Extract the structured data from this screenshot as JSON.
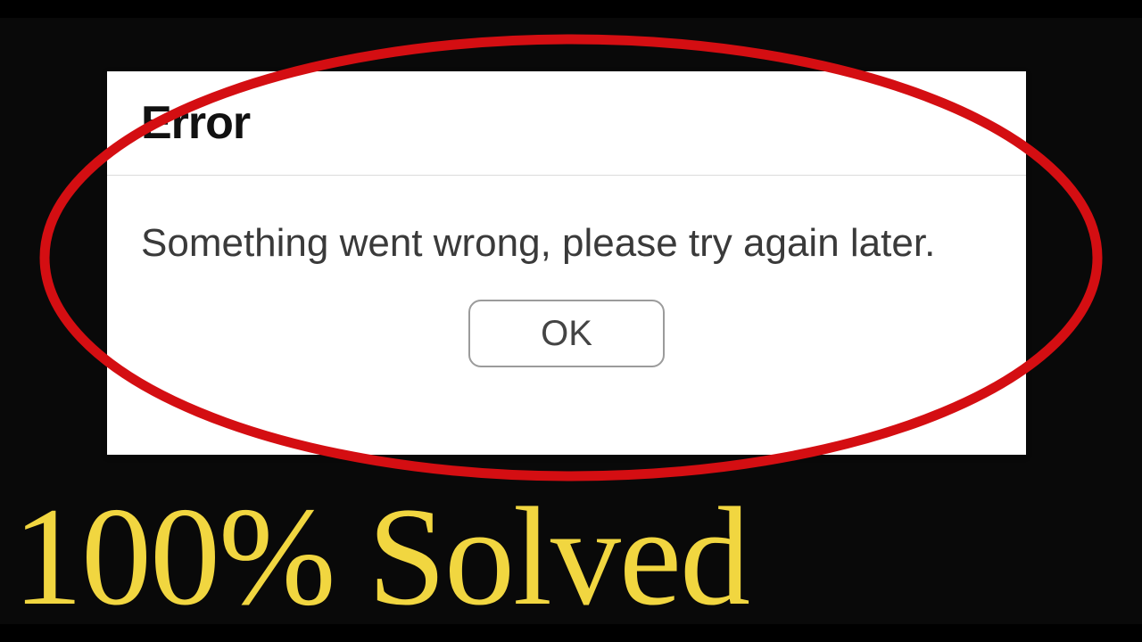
{
  "dialog": {
    "title": "Error",
    "message": "Something went wrong, please try again later.",
    "ok_label": "OK"
  },
  "overlay": {
    "banner_text": "100% Solved",
    "highlight_color": "#d40e12",
    "banner_color": "#f1d640"
  }
}
